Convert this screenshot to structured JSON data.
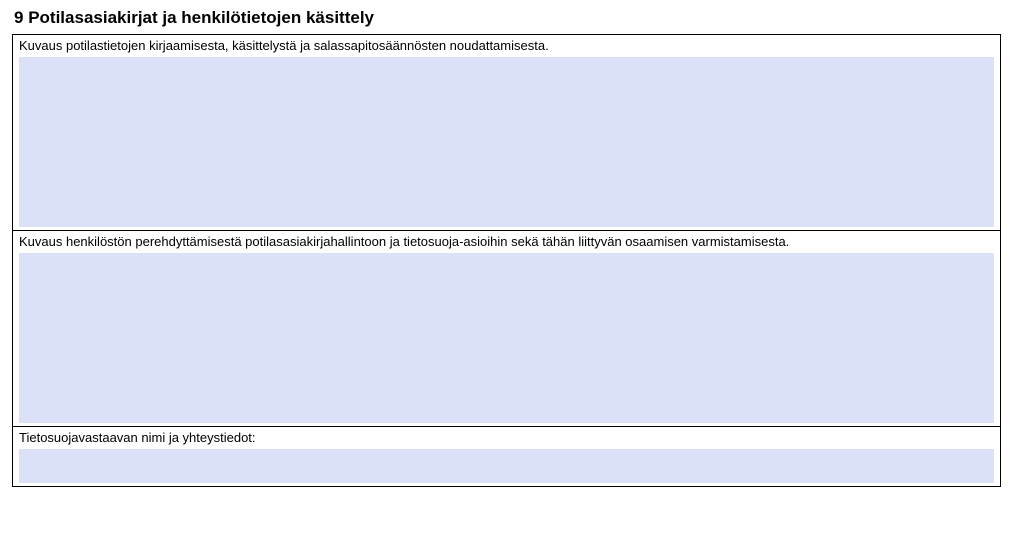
{
  "section": {
    "number": "9",
    "title": "Potilasasiakirjat ja henkilötietojen käsittely"
  },
  "fields": [
    {
      "label": "Kuvaus potilastietojen kirjaamisesta, käsittelystä ja salassapitosäännösten noudattamisesta.",
      "value": "",
      "size": "tall"
    },
    {
      "label": "Kuvaus henkilöstön perehdyttämisestä potilasasiakirjahallintoon ja  tietosuoja-asioihin sekä tähän liittyvän osaamisen varmistamisesta.",
      "value": "",
      "size": "tall"
    },
    {
      "label": "Tietosuojavastaavan nimi ja yhteystiedot:",
      "value": "",
      "size": "short"
    }
  ]
}
